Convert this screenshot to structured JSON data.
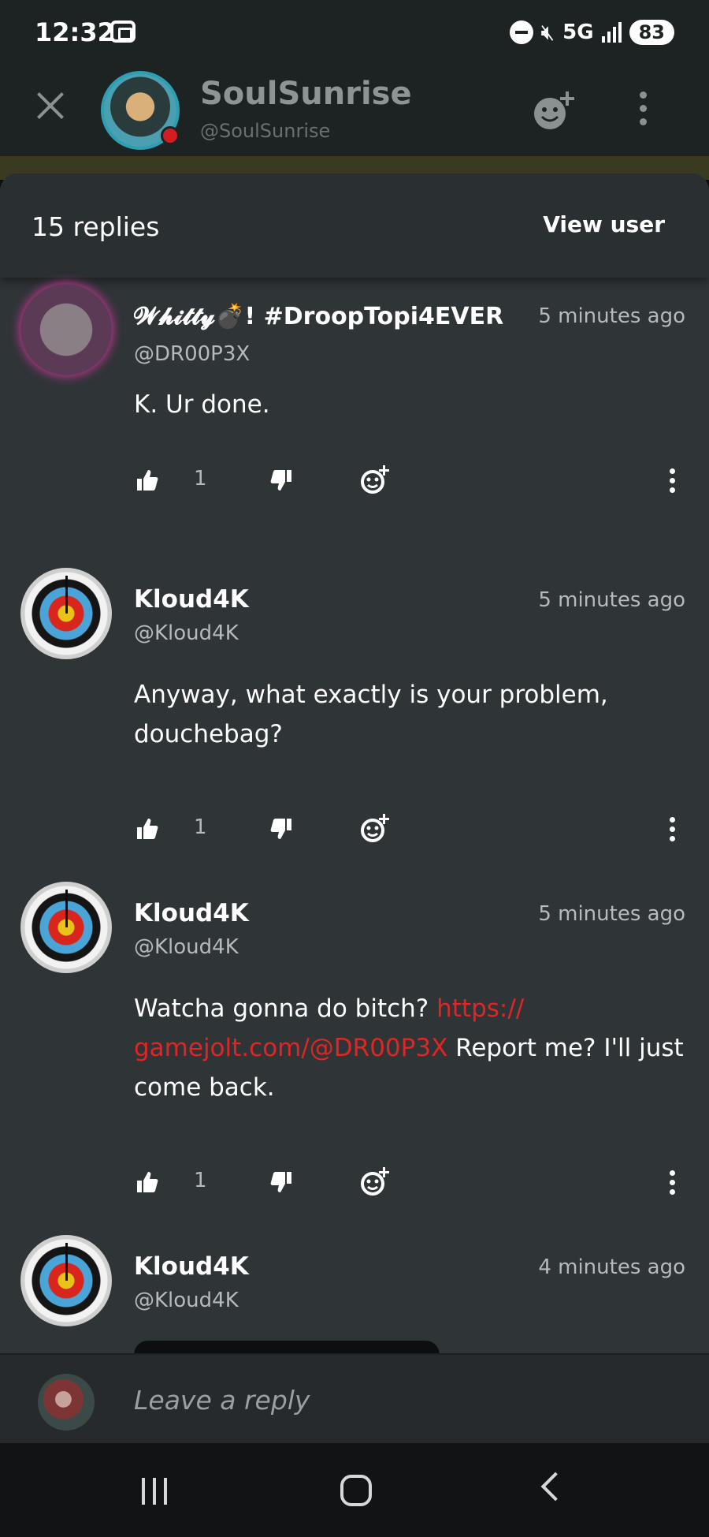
{
  "status_bar": {
    "time": "12:32",
    "network": "5G",
    "battery": "83"
  },
  "header": {
    "username": "SoulSunrise",
    "handle": "@SoulSunrise"
  },
  "sheet": {
    "replies_count": "15 replies",
    "view_user": "View user"
  },
  "comments": [
    {
      "name": "𝓦𝓱𝓲𝓽𝓽𝔂💣! #DroopTopi4EVER",
      "handle": "@DR00P3X",
      "time": "5 minutes ago",
      "body": "K. Ur done.",
      "likes": "1"
    },
    {
      "name": "Kloud4K",
      "handle": "@Kloud4K",
      "time": "5 minutes ago",
      "body": "Anyway, what exactly is your problem, douchebag?",
      "likes": "1"
    },
    {
      "name": "Kloud4K",
      "handle": "@Kloud4K",
      "time": "5 minutes ago",
      "body_pre": "Watcha gonna do bitch? ",
      "body_link": "https:// gamejolt.com/@DR00P3X",
      "body_post": " Report me? I'll just come back.",
      "likes": "1"
    },
    {
      "name": "Kloud4K",
      "handle": "@Kloud4K",
      "time": "4 minutes ago"
    }
  ],
  "reply_bar": {
    "placeholder": "Leave a reply"
  },
  "colors": {
    "sheet_bg": "#2f3437",
    "header_bg": "#1d2322",
    "link": "#e02525",
    "status_dot": "#d21e23"
  }
}
